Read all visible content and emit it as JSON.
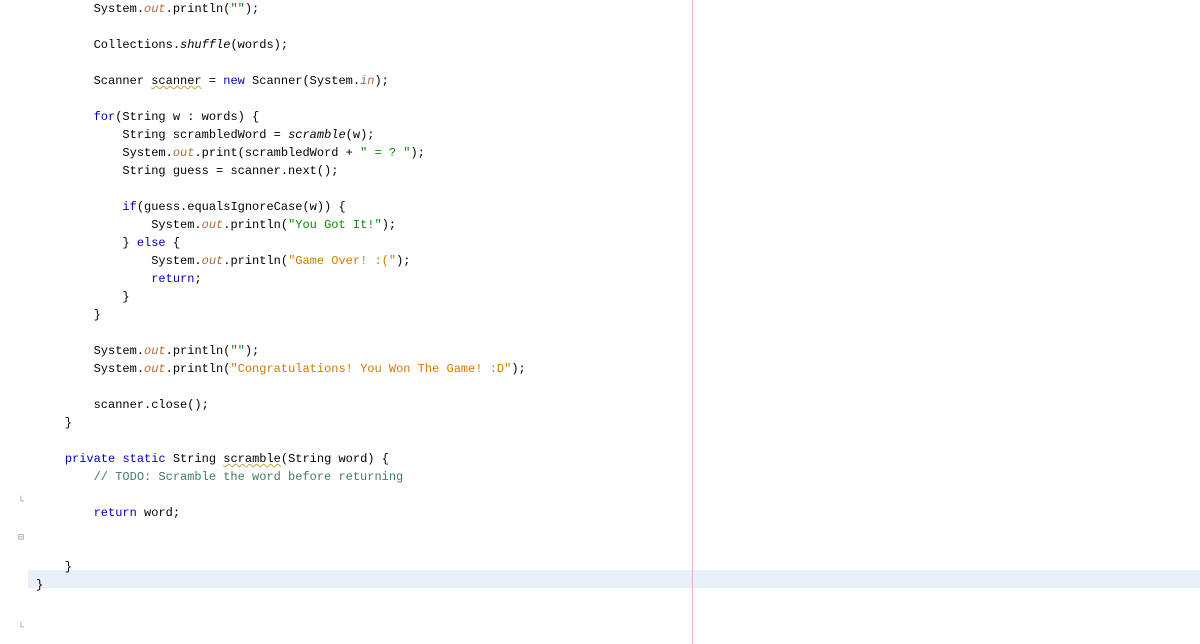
{
  "code": {
    "indent0": "        ",
    "indent1": "            ",
    "indent2": "                ",
    "line01_a": "System.",
    "line01_out": "out",
    "line01_b": ".println(",
    "line01_str": "\"\"",
    "line01_c": ");",
    "line02": "",
    "line03_a": "Collections.",
    "line03_m": "shuffle",
    "line03_b": "(words);",
    "line04": "",
    "line05_a": "Scanner ",
    "line05_var": "scanner",
    "line05_b": " = ",
    "line05_new": "new",
    "line05_c": " Scanner(System.",
    "line05_in": "in",
    "line05_d": ");",
    "line06": "",
    "line07_for": "for",
    "line07_a": "(String w : words) {",
    "line08_a": "String scrambledWord = ",
    "line08_m": "scramble",
    "line08_b": "(w);",
    "line09_a": "System.",
    "line09_out": "out",
    "line09_b": ".print(scrambledWord + ",
    "line09_str": "\" = ? \"",
    "line09_c": ");",
    "line10_a": "String guess = scanner.next();",
    "line11": "",
    "line12_if": "if",
    "line12_a": "(guess.equalsIgnoreCase(w)) {",
    "line13_a": "System.",
    "line13_out": "out",
    "line13_b": ".println(",
    "line13_str": "\"You Got It!\"",
    "line13_c": ");",
    "line14_a": "} ",
    "line14_else": "else",
    "line14_b": " {",
    "line15_a": "System.",
    "line15_out": "out",
    "line15_b": ".println(",
    "line15_str": "\"Game Over! :(\"",
    "line15_c": ");",
    "line16_return": "return",
    "line16_a": ";",
    "line17": "}",
    "line18": "}",
    "line19": "",
    "line20_a": "System.",
    "line20_out": "out",
    "line20_b": ".println(",
    "line20_str": "\"\"",
    "line20_c": ");",
    "line21_a": "System.",
    "line21_out": "out",
    "line21_b": ".println(",
    "line21_str": "\"Congratulations! You Won The Game! :D\"",
    "line21_c": ");",
    "line22": "",
    "line23_a": "scanner.close();",
    "line24": "    }",
    "line25": "",
    "line26_ind": "    ",
    "line26_priv": "private",
    "line26_sp1": " ",
    "line26_static": "static",
    "line26_sp2": " String ",
    "line26_m": "scramble",
    "line26_b": "(String word) {",
    "line27_ind": "        ",
    "line27_comment": "// TODO: Scramble the word before returning",
    "line28": "",
    "line29_ind": "        ",
    "line29_return": "return",
    "line29_a": " word;",
    "line30": "",
    "line31": "",
    "line32": "    }",
    "line33": "}"
  }
}
